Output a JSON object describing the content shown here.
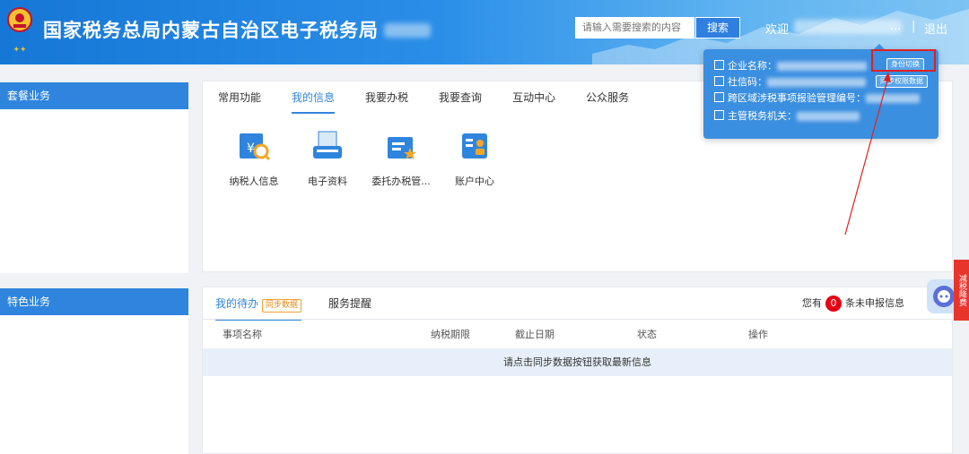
{
  "header": {
    "title": "国家税务总局内蒙古自治区电子税务局",
    "search_placeholder": "请输入需要搜索的内容",
    "search_button": "搜索",
    "welcome": "欢迎",
    "welcome_suffix": "...",
    "separator": "|",
    "logout": "退出"
  },
  "sidebar": {
    "section1": "套餐业务",
    "section2": "特色业务"
  },
  "main_tabs": [
    "常用功能",
    "我的信息",
    "我要办税",
    "我要查询",
    "互动中心",
    "公众服务"
  ],
  "apps": [
    {
      "label": "纳税人信息",
      "icon": "taxpayer-info-icon"
    },
    {
      "label": "电子资料",
      "icon": "electronic-docs-icon"
    },
    {
      "label": "委托办税管...",
      "icon": "entrust-tax-icon"
    },
    {
      "label": "账户中心",
      "icon": "account-center-icon"
    }
  ],
  "todo": {
    "tab_todo": "我的待办",
    "sync_badge": "同步数据",
    "tab_reminder": "服务提醒",
    "count_prefix": "您有",
    "count": "0",
    "count_suffix": "条未申报信息",
    "columns": [
      "事项名称",
      "纳税期限",
      "截止日期",
      "状态",
      "操作"
    ],
    "empty_message": "请点击同步数据按钮获取最新信息"
  },
  "popup": {
    "company_label": "企业名称：",
    "credit_label": "社信码：",
    "cross_label": "跨区域涉税事项报验管理编号：",
    "authority_label": "主管税务机关：",
    "switch_button": "身份切换",
    "sync_button": "同步权限数据"
  },
  "float_tab": "减税降费",
  "colors": {
    "header_blue": "#1677d6",
    "accent": "#2f85dd",
    "alert_red": "#e60012"
  }
}
